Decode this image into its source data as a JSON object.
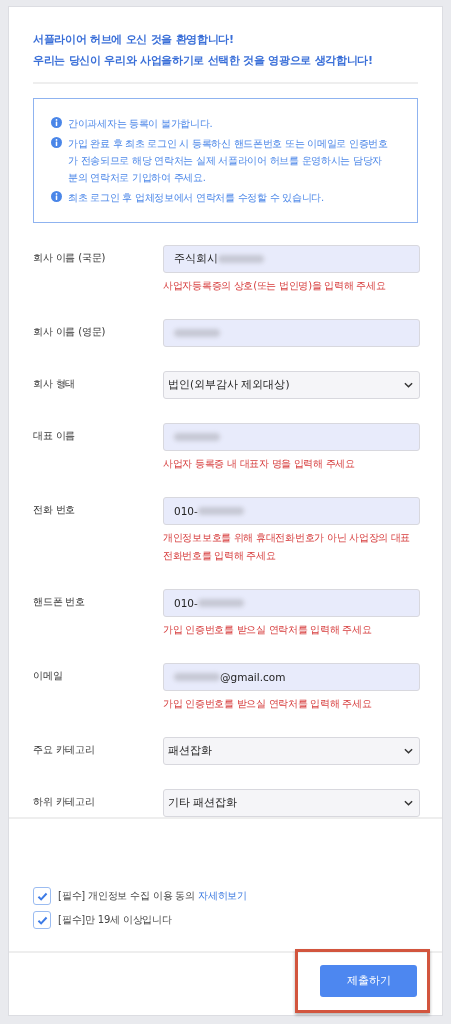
{
  "welcome": [
    "서플라이어 허브에 오신 것을 환영합니다!",
    "우리는 당신이 우리와 사업을하기로 선택한 것을 영광으로 생각합니다!"
  ],
  "notices": [
    {
      "text": "간이과세자는 등록이 불가합니다."
    },
    {
      "text": "가입 완료 후 최초 로그인 시 등록하신 핸드폰번호 또는 이메일로 인증번호가 전송되므로 해당 연락처는 실제 서플라이어 허브를 운영하시는 담당자분의 연락처로 기입하여 주세요."
    },
    {
      "text": "최초 로그인 후 업체정보에서 연락처를 수정할 수 있습니다."
    }
  ],
  "fields": [
    {
      "label": "회사 이름 (국문)",
      "kind": "input",
      "value": "주식회시",
      "blur_after": true,
      "help": "사업자등록증의 상호(또는 법인명)을 입력해 주세요"
    },
    {
      "label": "회사 이름 (영문)",
      "kind": "input",
      "blur_before": true
    },
    {
      "label": "회사 형태",
      "kind": "select",
      "value": "법인(외부감사 제외대상)"
    },
    {
      "label": "대표 이름",
      "kind": "input",
      "blur_before": true,
      "help": "사업자 등록증 내 대표자 명을 입력해 주세요"
    },
    {
      "label": "전화 번호",
      "kind": "input",
      "value": "010-",
      "blur_after": true,
      "help": "개인정보보호를 위해 휴대전화번호가 아닌 사업장의 대표 전화번호를 입력해 주세요"
    },
    {
      "label": "핸드폰 번호",
      "kind": "input",
      "value": "010-",
      "blur_after": true,
      "help": "가입 인증번호를 받으실 연락처를 입력해 주세요"
    },
    {
      "label": "이메일",
      "kind": "input",
      "value": "@gmail.com",
      "blur_before": true,
      "help": "가입 인증번호를 받으실 연락처를 입력해 주세요"
    },
    {
      "label": "주요 카테고리",
      "kind": "select",
      "value": "패션잡화"
    },
    {
      "label": "하위 카테고리",
      "kind": "select",
      "value": "기타 패션잡화"
    }
  ],
  "agreements": [
    {
      "text": "[필수] 개인정보 수집 이용 동의 ",
      "link": "자세히보기",
      "checked": true
    },
    {
      "text": "[필수]만 19세 이상입니다",
      "checked": true
    }
  ],
  "submit": {
    "label": "제출하기",
    "highlighted": true
  }
}
